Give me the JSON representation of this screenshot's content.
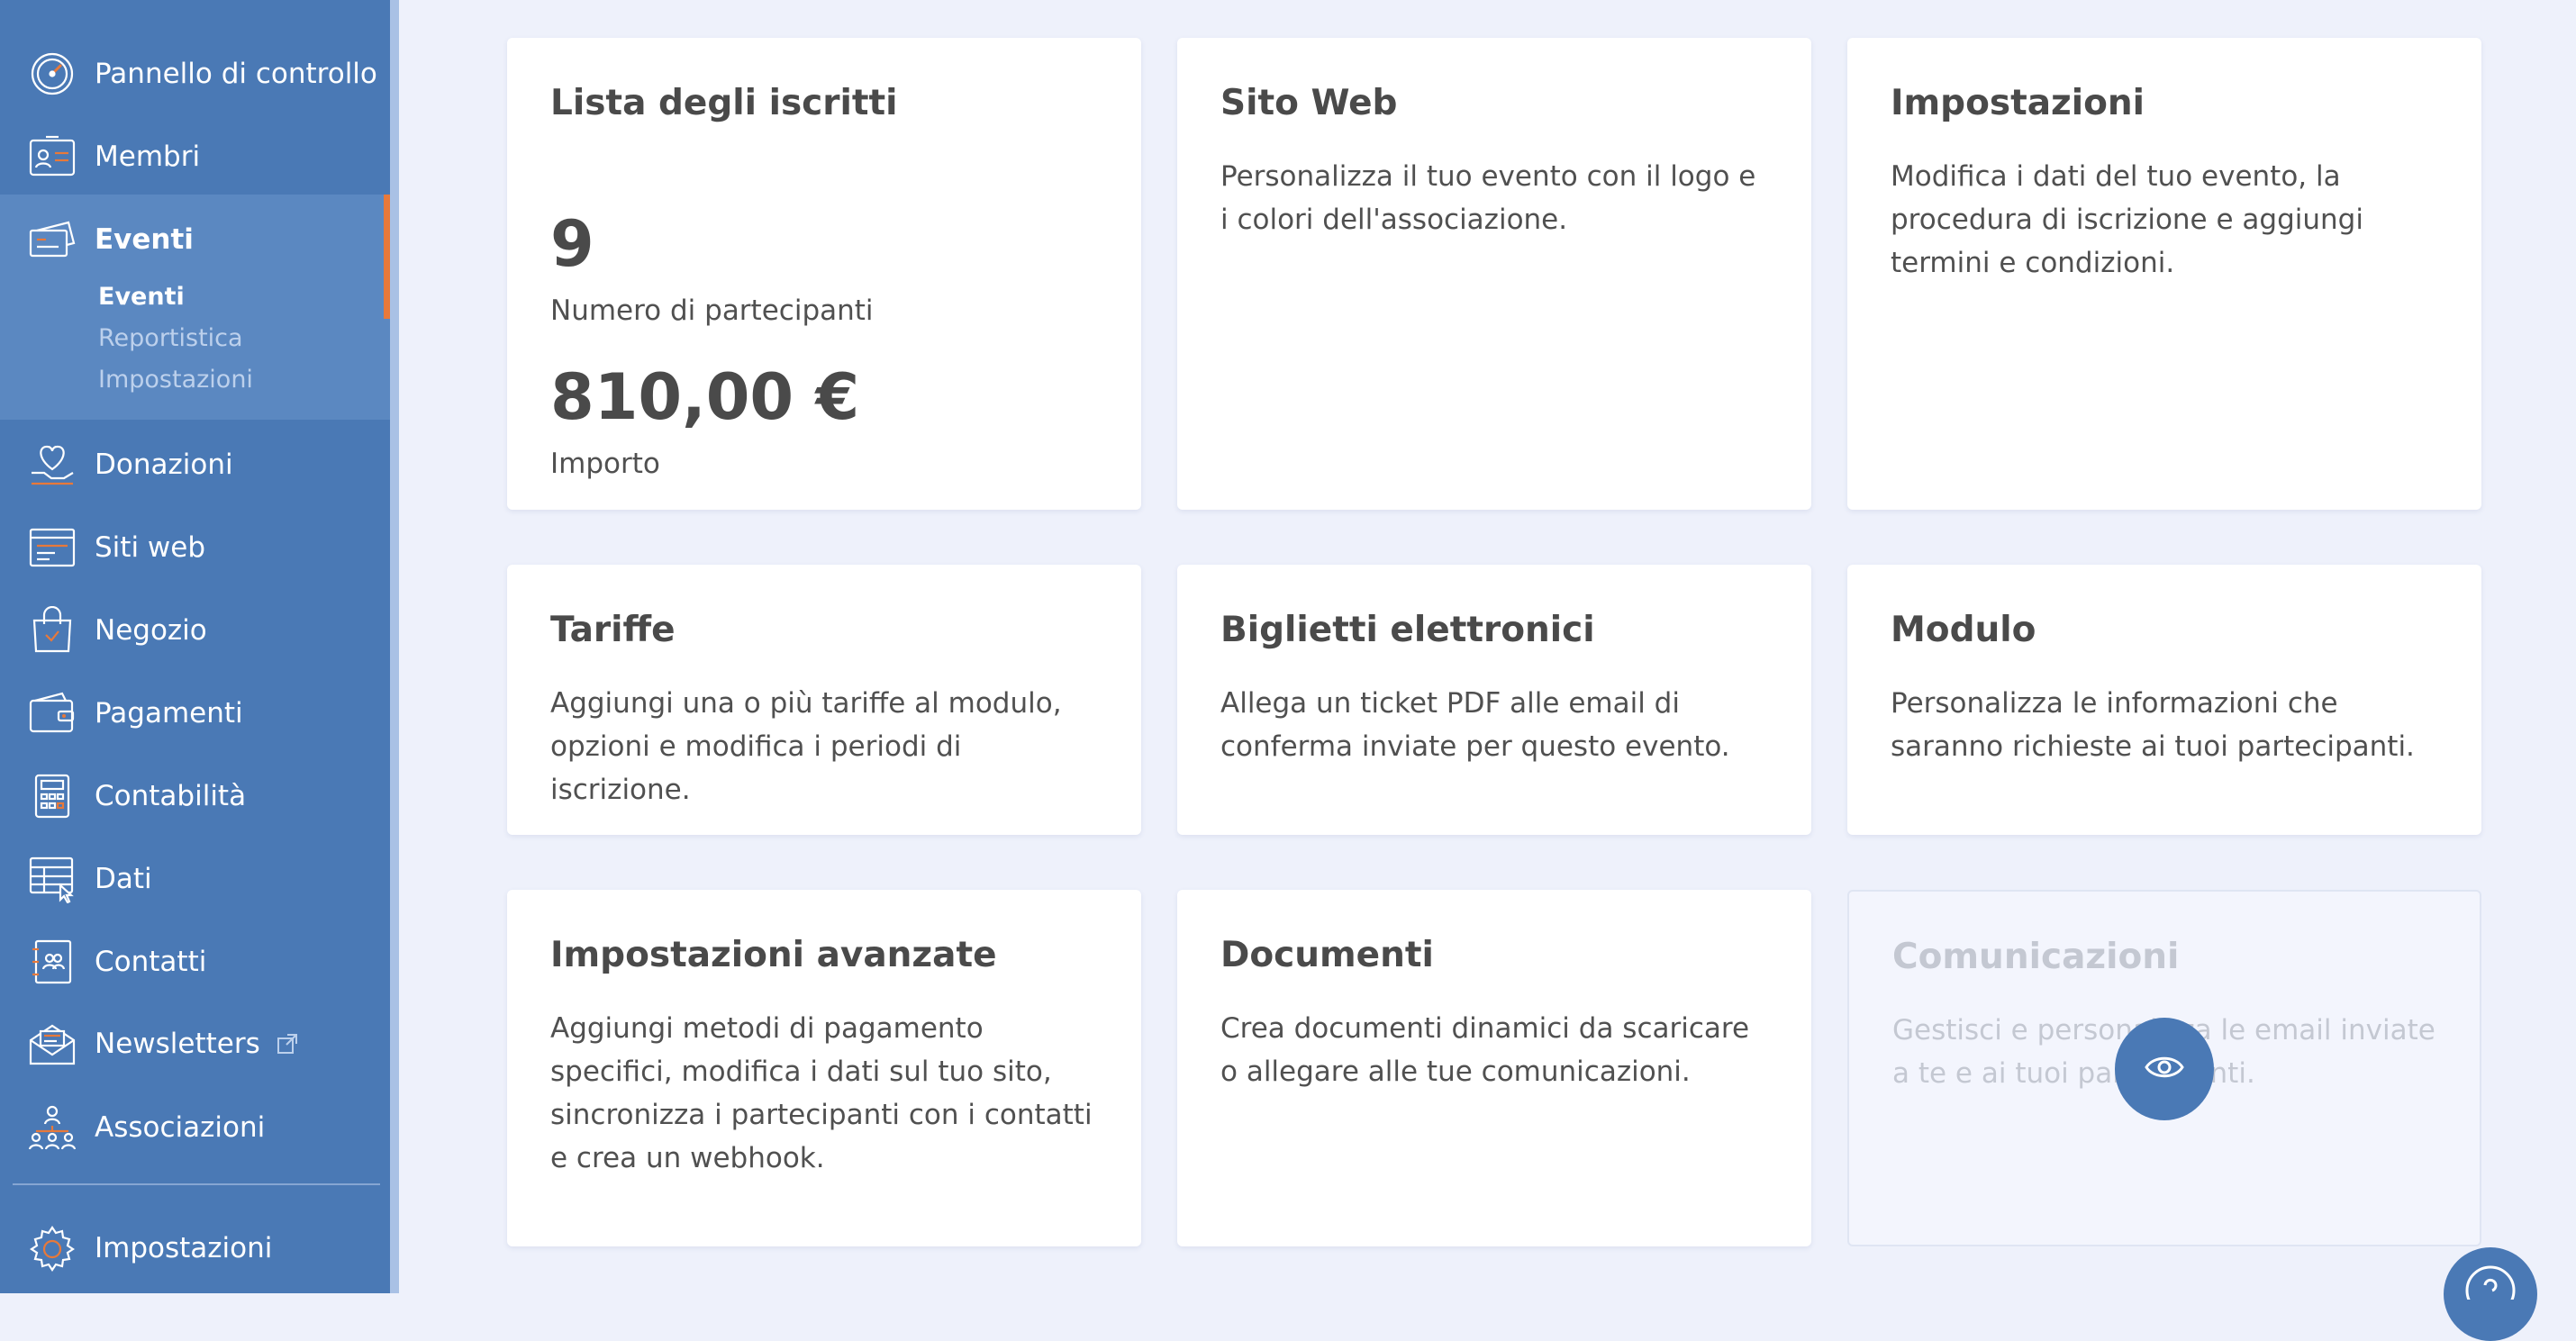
{
  "sidebar": {
    "items": [
      {
        "label": "Pannello di controllo",
        "icon": "dashboard-gauge-icon"
      },
      {
        "label": "Membri",
        "icon": "member-card-icon"
      },
      {
        "label": "Eventi",
        "icon": "event-tickets-icon"
      },
      {
        "label": "Donazioni",
        "icon": "donation-heart-icon"
      },
      {
        "label": "Siti web",
        "icon": "website-icon"
      },
      {
        "label": "Negozio",
        "icon": "shopping-bag-icon"
      },
      {
        "label": "Pagamenti",
        "icon": "wallet-icon"
      },
      {
        "label": "Contabilità",
        "icon": "calculator-icon"
      },
      {
        "label": "Dati",
        "icon": "data-table-icon"
      },
      {
        "label": "Contatti",
        "icon": "address-book-icon"
      },
      {
        "label": "Newsletters",
        "icon": "envelope-icon"
      },
      {
        "label": "Associazioni",
        "icon": "organization-icon"
      },
      {
        "label": "Impostazioni",
        "icon": "gear-icon"
      }
    ],
    "active": "Eventi",
    "subitems": [
      {
        "label": "Eventi"
      },
      {
        "label": "Reportistica"
      },
      {
        "label": "Impostazioni"
      }
    ]
  },
  "cards": {
    "iscritti": {
      "title": "Lista degli iscritti",
      "participants_count": "9",
      "participants_label": "Numero di partecipanti",
      "amount": "810,00 €",
      "amount_label": "Importo"
    },
    "sito_web": {
      "title": "Sito Web",
      "description": "Personalizza il tuo evento con il logo e i colori dell'associazione."
    },
    "impostazioni": {
      "title": "Impostazioni",
      "description": "Modifica i dati del tuo evento, la procedura di iscrizione e aggiungi termini e condizioni."
    },
    "tariffe": {
      "title": "Tariffe",
      "description": "Aggiungi una o più tariffe al modulo, opzioni e modifica i periodi di iscrizione."
    },
    "biglietti": {
      "title": "Biglietti elettronici",
      "description": "Allega un ticket PDF alle email di conferma inviate per questo evento."
    },
    "modulo": {
      "title": "Modulo",
      "description": "Personalizza le informazioni che saranno richieste ai tuoi partecipanti."
    },
    "avanzate": {
      "title": "Impostazioni avanzate",
      "description": "Aggiungi metodi di pagamento specifici, modifica i dati sul tuo sito, sincronizza i partecipanti con i contatti e crea un webhook."
    },
    "documenti": {
      "title": "Documenti",
      "description": "Crea documenti dinamici da scaricare o allegare alle tue comunicazioni."
    },
    "comunicazioni": {
      "title": "Comunicazioni",
      "description": "Gestisci e personalizza le email inviate a te e ai tuoi partecipanti."
    }
  },
  "colors": {
    "sidebar": "#4a79b5",
    "active_marker": "#e8793a",
    "background": "#eef1fb",
    "accent_icon": "#e8793a"
  },
  "floating": {
    "preview_icon": "eye-icon",
    "help_icon": "help-question-icon"
  }
}
